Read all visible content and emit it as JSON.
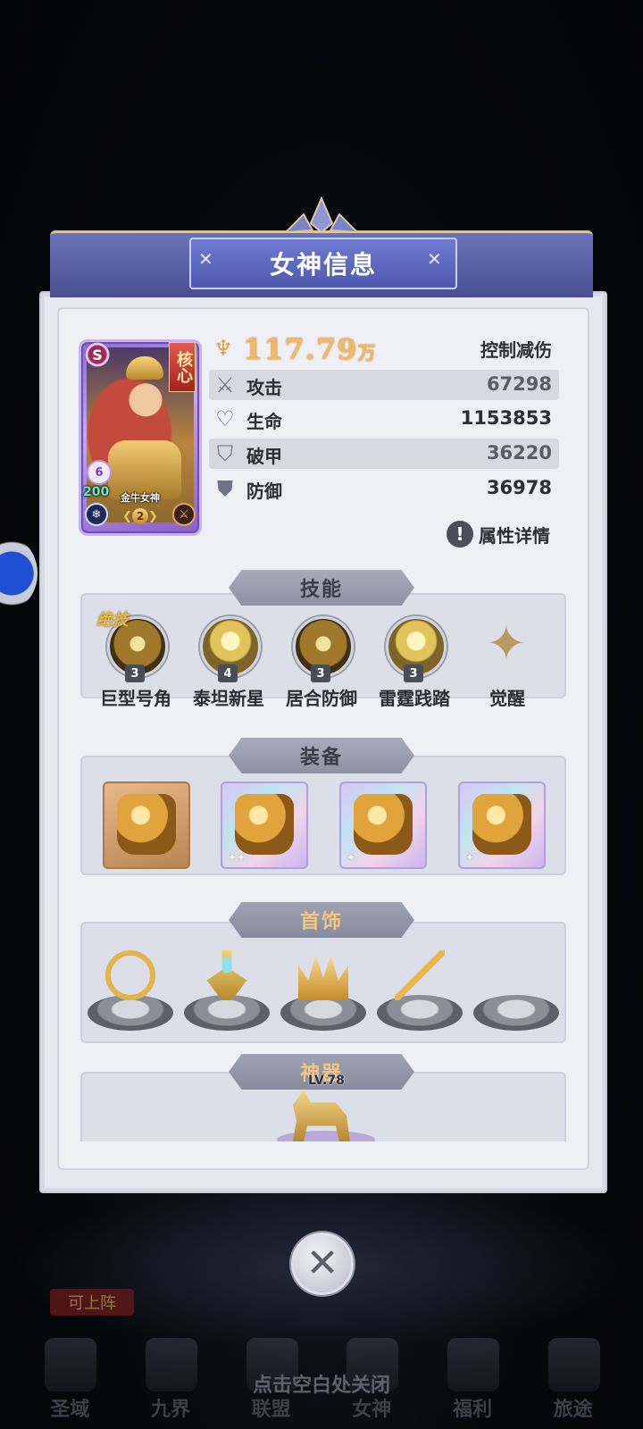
{
  "dialog": {
    "title": "女神信息"
  },
  "character": {
    "name": "金牛女神",
    "grade": "S",
    "core_tag": "核心",
    "stars": "6",
    "level": "200",
    "rank": "2"
  },
  "power": {
    "value": "117.79",
    "unit": "万",
    "role": "控制减伤"
  },
  "stats": [
    {
      "label": "攻击",
      "value": "67298",
      "icon": "swords-icon"
    },
    {
      "label": "生命",
      "value": "1153853",
      "icon": "heart-icon"
    },
    {
      "label": "破甲",
      "value": "36220",
      "icon": "broken-shield-icon"
    },
    {
      "label": "防御",
      "value": "36978",
      "icon": "shield-icon"
    }
  ],
  "attribute_details": "属性详情",
  "skills": {
    "title": "技能",
    "ultimate_tag": "绝技",
    "items": [
      {
        "name": "巨型号角",
        "level": "3"
      },
      {
        "name": "泰坦新星",
        "level": "4"
      },
      {
        "name": "居合防御",
        "level": "3"
      },
      {
        "name": "雷霆践踏",
        "level": "3"
      },
      {
        "name": "觉醒"
      }
    ]
  },
  "equipment": {
    "title": "装备",
    "items": [
      {
        "type": "shoulder-guard",
        "stars": ""
      },
      {
        "type": "helmet",
        "stars": "✦✦"
      },
      {
        "type": "chest-armor",
        "stars": "✦"
      },
      {
        "type": "boots",
        "stars": "✦"
      }
    ]
  },
  "accessories": {
    "title": "首饰",
    "items": [
      {
        "type": "gold-earrings"
      },
      {
        "type": "gem-earrings"
      },
      {
        "type": "crown"
      },
      {
        "type": "scepter"
      },
      {
        "type": "empty"
      }
    ]
  },
  "artifact": {
    "title": "神器",
    "level": "LV.78"
  },
  "bottom_nav": [
    "圣域",
    "九界",
    "联盟",
    "女神",
    "福利",
    "旅途"
  ],
  "background_badge": "可上阵",
  "close_hint": "点击空白处关闭",
  "colors": {
    "accent_gold": "#f0b867",
    "banner_blue": "#4e59ad",
    "panel_bg": "#eef0f6"
  }
}
